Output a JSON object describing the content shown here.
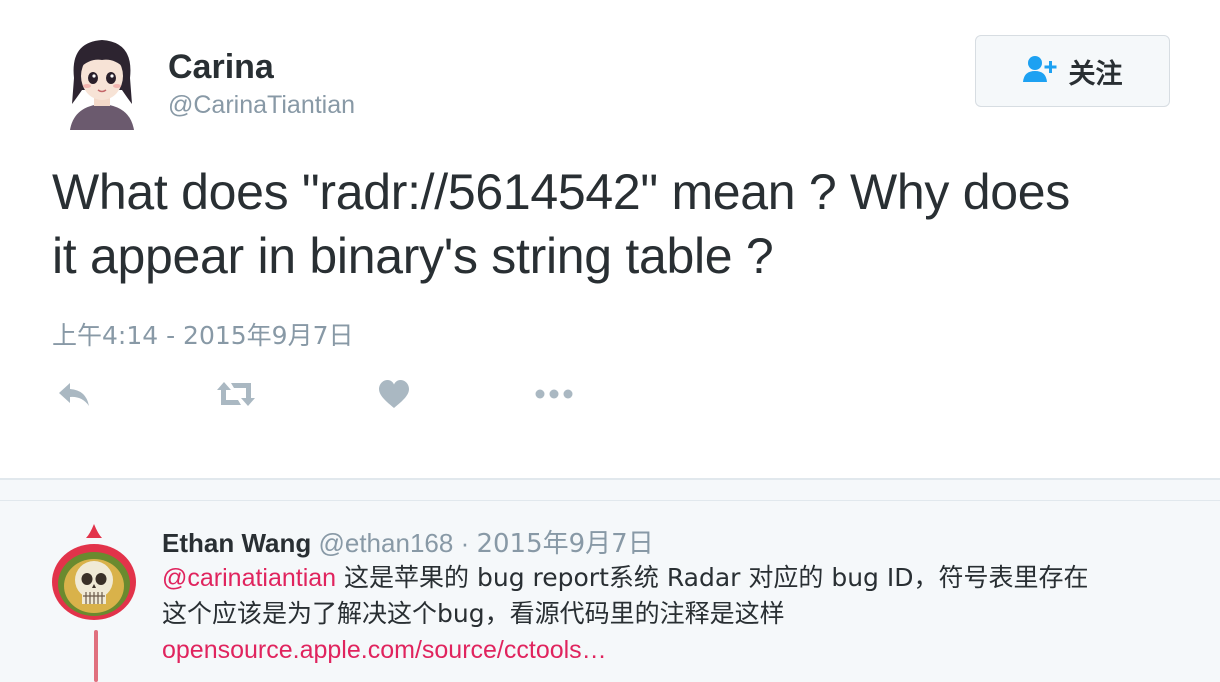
{
  "tweet": {
    "author": {
      "name": "Carina",
      "handle": "@CarinaTiantian"
    },
    "follow_button": {
      "label": "关注",
      "icon": "follow-user-icon"
    },
    "text_line1": "What does \"radr://5614542\" mean ? Why does",
    "text_line2": "it appear in binary's string table ?",
    "timestamp": "上午4:14 - 2015年9月7日",
    "actions": [
      {
        "icon": "reply-icon"
      },
      {
        "icon": "retweet-icon"
      },
      {
        "icon": "heart-icon"
      },
      {
        "icon": "more-icon"
      }
    ]
  },
  "reply": {
    "name": "Ethan Wang",
    "handle": "@ethan168",
    "separator": "·",
    "date": "2015年9月7日",
    "mention": "@carinatiantian",
    "body_line1": " 这是苹果的 bug report系统 Radar 对应的 bug ID，符号表里存在",
    "body_line2": "这个应该是为了解决这个bug，看源代码里的注释是这样",
    "link": "opensource.apple.com/source/cctools…"
  },
  "colors": {
    "link_pink": "#e0245e",
    "muted_gray": "#8899a6",
    "text_dark": "#292f33",
    "follow_blue": "#1da1f2"
  }
}
